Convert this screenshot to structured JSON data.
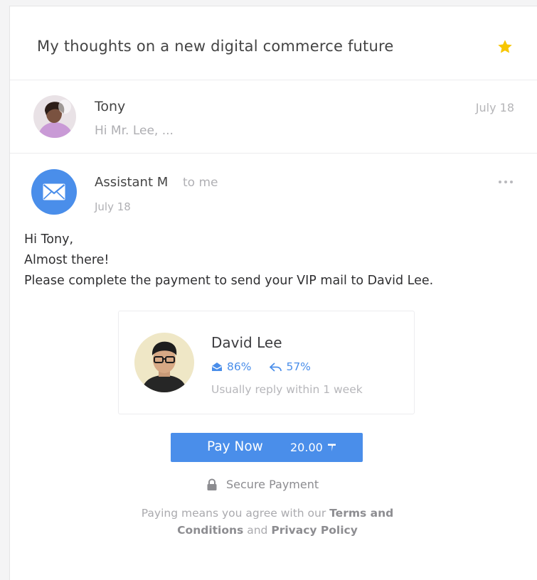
{
  "email": {
    "subject": "My thoughts on a new digital commerce future",
    "starred": true
  },
  "thread": {
    "previous": {
      "sender": "Tony",
      "preview": "Hi Mr. Lee, ...",
      "date": "July 18"
    },
    "current": {
      "sender": "Assistant M",
      "recipient": "to me",
      "date": "July 18",
      "body_lines": [
        "Hi Tony,",
        "Almost there!",
        "Please complete the payment to send your VIP mail to David Lee."
      ]
    }
  },
  "profile": {
    "name": "David Lee",
    "open_rate": "86%",
    "reply_rate": "57%",
    "reply_time": "Usually reply within 1 week"
  },
  "payment": {
    "button_label": "Pay Now",
    "amount": "20.00",
    "secure_label": "Secure Payment",
    "legal_prefix": "Paying means you agree with our",
    "terms_link": "Terms and Conditions",
    "legal_and": "and",
    "privacy_link": "Privacy Policy"
  },
  "colors": {
    "accent": "#4a8eea",
    "star": "#f7c600"
  },
  "icons": {
    "star": "star-icon",
    "mail": "envelope-icon",
    "more": "more-horizontal-icon",
    "open_rate": "open-envelope-icon",
    "reply_rate": "reply-arrow-icon",
    "currency": "token-icon",
    "secure": "lock-icon"
  }
}
